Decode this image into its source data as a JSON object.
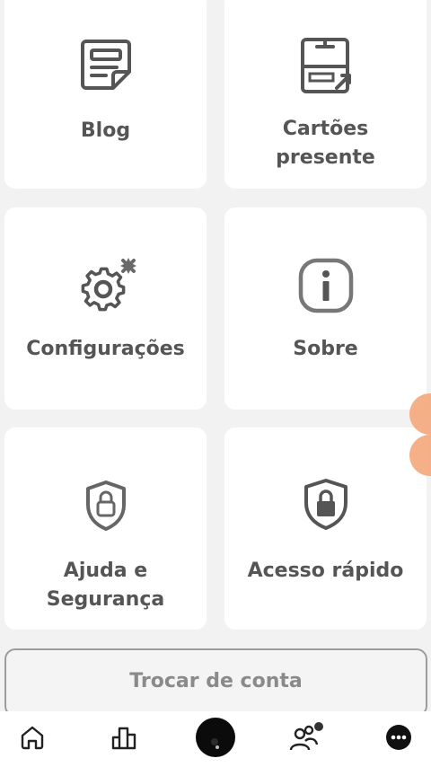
{
  "cards": [
    {
      "label": "Blog",
      "icon": "blog-document-icon"
    },
    {
      "label": "Cartões\npresente",
      "icon": "gift-card-icon"
    },
    {
      "label": "Configurações",
      "icon": "settings-gear-icon"
    },
    {
      "label": "Sobre",
      "icon": "info-icon"
    },
    {
      "label": "Ajuda e\nSegurança",
      "icon": "shield-lock-icon"
    },
    {
      "label": "Acesso rápido",
      "icon": "shield-lock-filled-icon"
    }
  ],
  "switch_account_label": "Trocar de conta",
  "bottom_nav": [
    {
      "name": "home",
      "icon": "home-icon"
    },
    {
      "name": "stats",
      "icon": "bar-chart-icon"
    },
    {
      "name": "profile",
      "icon": "avatar"
    },
    {
      "name": "friends",
      "icon": "people-icon",
      "has_badge": true
    },
    {
      "name": "more",
      "icon": "more-icon"
    }
  ],
  "colors": {
    "background": "#f2f2f2",
    "card": "#ffffff",
    "icon": "#555555",
    "accent_bubble": "#f4a77a"
  }
}
